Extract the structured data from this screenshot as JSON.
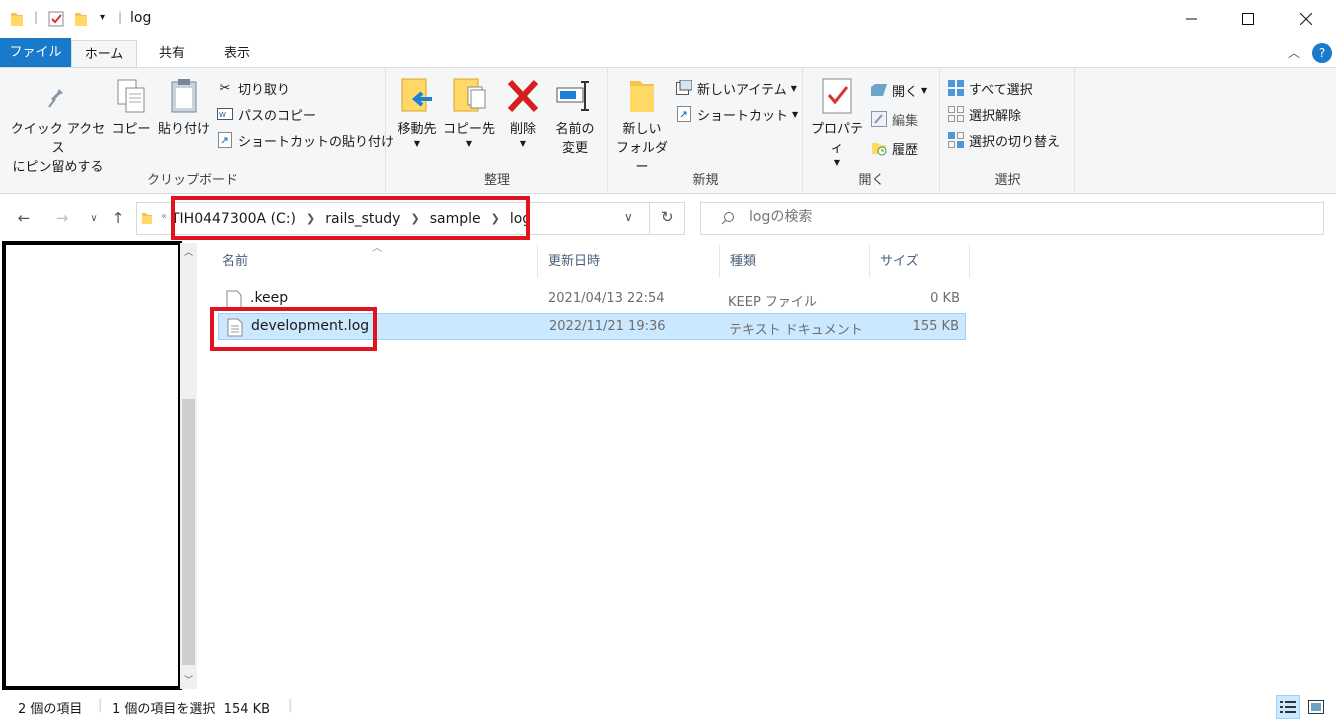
{
  "window": {
    "title": "log"
  },
  "tabs": {
    "file": "ファイル",
    "home": "ホーム",
    "share": "共有",
    "view": "表示"
  },
  "ribbon": {
    "clipboard": {
      "label": "クリップボード",
      "pin_line1": "クイック アクセス",
      "pin_line2": "にピン留めする",
      "copy": "コピー",
      "paste": "貼り付け",
      "cut": "切り取り",
      "copy_path": "パスのコピー",
      "paste_shortcut": "ショートカットの貼り付け"
    },
    "organize": {
      "label": "整理",
      "move_to": "移動先",
      "copy_to": "コピー先",
      "delete": "削除",
      "rename_line1": "名前の",
      "rename_line2": "変更"
    },
    "new": {
      "label": "新規",
      "new_folder_line1": "新しい",
      "new_folder_line2": "フォルダー",
      "new_item": "新しいアイテム",
      "shortcut": "ショートカット"
    },
    "open": {
      "label": "開く",
      "properties": "プロパティ",
      "open": "開く",
      "edit": "編集",
      "history": "履歴"
    },
    "select": {
      "label": "選択",
      "select_all": "すべて選択",
      "select_none": "選択解除",
      "invert": "選択の切り替え"
    }
  },
  "address": {
    "crumbs": [
      "TIH0447300A (C:)",
      "rails_study",
      "sample",
      "log"
    ]
  },
  "search": {
    "placeholder": "logの検索"
  },
  "columns": {
    "name": "名前",
    "modified": "更新日時",
    "type": "種類",
    "size": "サイズ"
  },
  "files": [
    {
      "name": ".keep",
      "modified": "2021/04/13 22:54",
      "type": "KEEP ファイル",
      "size": "0 KB"
    },
    {
      "name": "development.log",
      "modified": "2022/11/21 19:36",
      "type": "テキスト ドキュメント",
      "size": "155 KB"
    }
  ],
  "status": {
    "item_count": "2 個の項目",
    "selection": "1 個の項目を選択  154 KB"
  },
  "colors": {
    "accent": "#1979ca",
    "selection": "#cce8ff",
    "highlight_box": "#e0141e"
  }
}
